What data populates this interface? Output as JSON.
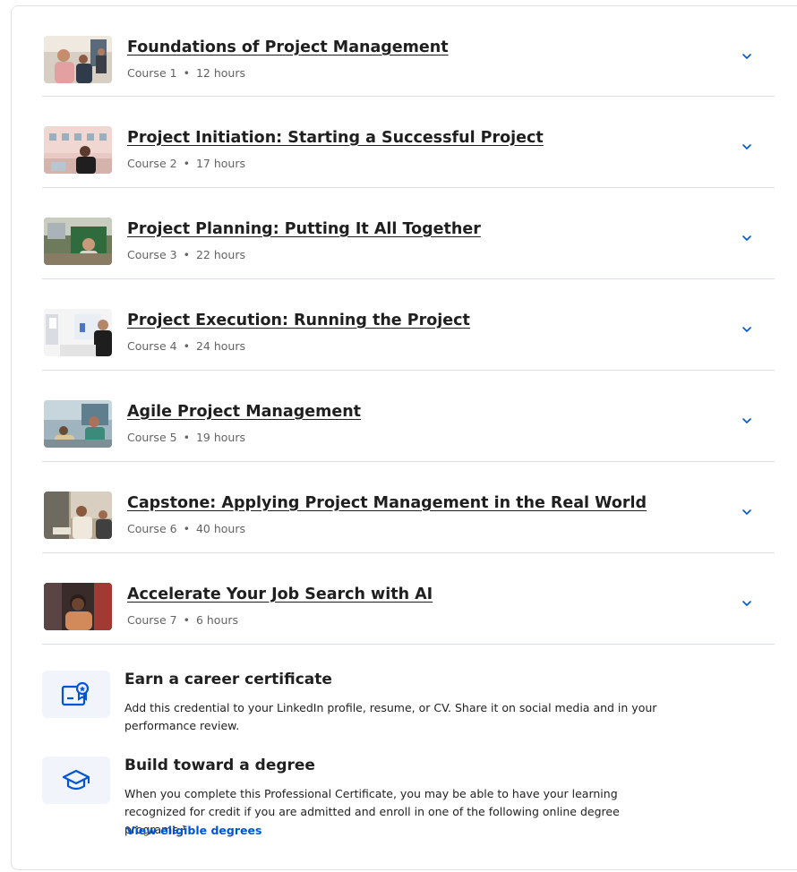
{
  "colors": {
    "accent": "#0056d2",
    "divider": "#dadde2",
    "icon_bg": "#f1f5fb"
  },
  "courses": [
    {
      "title": "Foundations of Project Management",
      "course_label": "Course 1",
      "duration": "12 hours"
    },
    {
      "title": "Project Initiation: Starting a Successful Project",
      "course_label": "Course 2",
      "duration": "17 hours"
    },
    {
      "title": "Project Planning: Putting It All Together",
      "course_label": "Course 3",
      "duration": "22 hours"
    },
    {
      "title": "Project Execution: Running the Project",
      "course_label": "Course 4",
      "duration": "24 hours"
    },
    {
      "title": "Agile Project Management",
      "course_label": "Course 5",
      "duration": "19 hours"
    },
    {
      "title": "Capstone: Applying Project Management in the Real World",
      "course_label": "Course 6",
      "duration": "40 hours"
    },
    {
      "title": "Accelerate Your Job Search with AI",
      "course_label": "Course 7",
      "duration": "6 hours"
    }
  ],
  "meta_separator": "•",
  "benefits": {
    "certificate": {
      "icon": "certificate-icon",
      "title": "Earn a career certificate",
      "description": "Add this credential to your LinkedIn profile, resume, or CV. Share it on social media and in your performance review."
    },
    "degree": {
      "icon": "graduation-cap-icon",
      "title": "Build toward a degree",
      "description": "When you complete this Professional Certificate, you may be able to have your learning recognized for credit if you are admitted and enroll in one of the following online degree programs.¹",
      "link_label": "View eligible degrees"
    }
  }
}
